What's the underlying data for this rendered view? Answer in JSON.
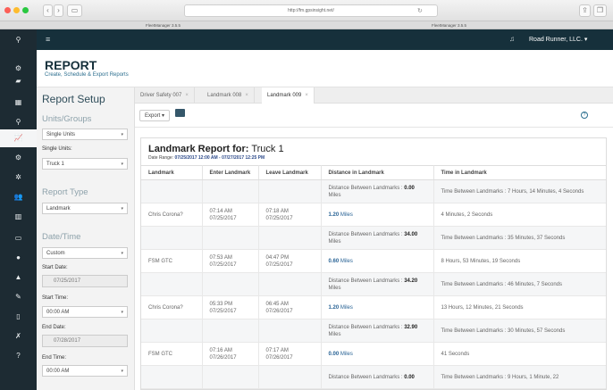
{
  "browser": {
    "url": "http://fm.gpsinsight.net/",
    "tab_left": "FleetManager 3.5.5",
    "tab_right": "FleetManager 3.5.5"
  },
  "topbar": {
    "account": "Road Runner, LLC. ▾"
  },
  "header": {
    "title": "REPORT",
    "subtitle": "Create, Schedule & Export Reports"
  },
  "setup": {
    "title": "Report Setup",
    "units_heading": "Units/Groups",
    "units_mode": "Single Units",
    "single_units_label": "Single Units:",
    "single_unit": "Truck 1",
    "report_type_heading": "Report Type",
    "report_type": "Landmark",
    "datetime_heading": "Date/Time",
    "date_mode": "Custom",
    "start_date_label": "Start Date:",
    "start_date": "07/25/2017",
    "start_time_label": "Start Time:",
    "start_time": "00:00 AM",
    "end_date_label": "End Date:",
    "end_date": "07/28/2017",
    "end_time_label": "End Time:",
    "end_time": "00:00 AM"
  },
  "report_tabs": [
    {
      "label": "Driver Safety 007",
      "close": "×"
    },
    {
      "label": "Landmark 008",
      "close": "×"
    },
    {
      "label": "Landmark 009",
      "close": "×"
    }
  ],
  "toolbar": {
    "export_label": "Export ▾",
    "help_icon": "?"
  },
  "report": {
    "title_bold": "Landmark Report for:",
    "title_unit": " Truck 1",
    "date_range_label": "Date Range: ",
    "date_range": "07/25/2017 12:00 AM - 07/27/2017 12:25 PM",
    "columns": [
      "Landmark",
      "Enter Landmark",
      "Leave Landmark",
      "Distance in Landmark",
      "Time in Landmark"
    ]
  },
  "rows": [
    {
      "type": "gap",
      "distance_label": "Distance Between Landmarks : ",
      "distance": "0.00",
      "distance_unit": "Miles",
      "time": "Time Between Landmarks : 7 Hours, 14 Minutes, 4 Seconds"
    },
    {
      "type": "stop",
      "landmark": "Chris Corona?",
      "enter_time": "07:14 AM",
      "enter_date": "07/25/2017",
      "leave_time": "07:18 AM",
      "leave_date": "07/25/2017",
      "distance": "1.20",
      "distance_unit": "Miles",
      "time": "4 Minutes, 2 Seconds"
    },
    {
      "type": "gap",
      "distance_label": "Distance Between Landmarks : ",
      "distance": "34.00",
      "distance_unit": "Miles",
      "time": "Time Between Landmarks : 35 Minutes, 37 Seconds"
    },
    {
      "type": "stop",
      "landmark": "FSM GTC",
      "enter_time": "07:53 AM",
      "enter_date": "07/25/2017",
      "leave_time": "04:47 PM",
      "leave_date": "07/25/2017",
      "distance": "0.60",
      "distance_unit": "Miles",
      "time": "8 Hours, 53 Minutes, 19 Seconds"
    },
    {
      "type": "gap",
      "distance_label": "Distance Between Landmarks : ",
      "distance": "34.20",
      "distance_unit": "Miles",
      "time": "Time Between Landmarks : 46 Minutes, 7 Seconds"
    },
    {
      "type": "stop",
      "landmark": "Chris Corona?",
      "enter_time": "05:33 PM",
      "enter_date": "07/25/2017",
      "leave_time": "06:45 AM",
      "leave_date": "07/26/2017",
      "distance": "1.20",
      "distance_unit": "Miles",
      "time": "13 Hours, 12 Minutes, 21 Seconds"
    },
    {
      "type": "gap",
      "distance_label": "Distance Between Landmarks : ",
      "distance": "32.90",
      "distance_unit": "Miles",
      "time": "Time Between Landmarks : 30 Minutes, 57 Seconds"
    },
    {
      "type": "stop",
      "landmark": "FSM GTC",
      "enter_time": "07:16 AM",
      "enter_date": "07/26/2017",
      "leave_time": "07:17 AM",
      "leave_date": "07/26/2017",
      "distance": "0.00",
      "distance_unit": "Miles",
      "time": "41 Seconds"
    },
    {
      "type": "gap",
      "distance_label": "Distance Between Landmarks : ",
      "distance": "0.00",
      "distance_unit": "",
      "time": "Time Between Landmarks : 9 Hours, 1 Minute, 22"
    }
  ],
  "colors": {
    "sidebar": "#1d2b33",
    "topbar": "#16303b",
    "accent": "#2d4a8a",
    "header_title": "#16303b"
  },
  "icons": [
    "location-pin-icon",
    "menu-icon",
    "vehicle-icon",
    "map-icon",
    "chart-icon",
    "settings-icon",
    "users-icon",
    "barcode-icon",
    "notification-icon"
  ]
}
